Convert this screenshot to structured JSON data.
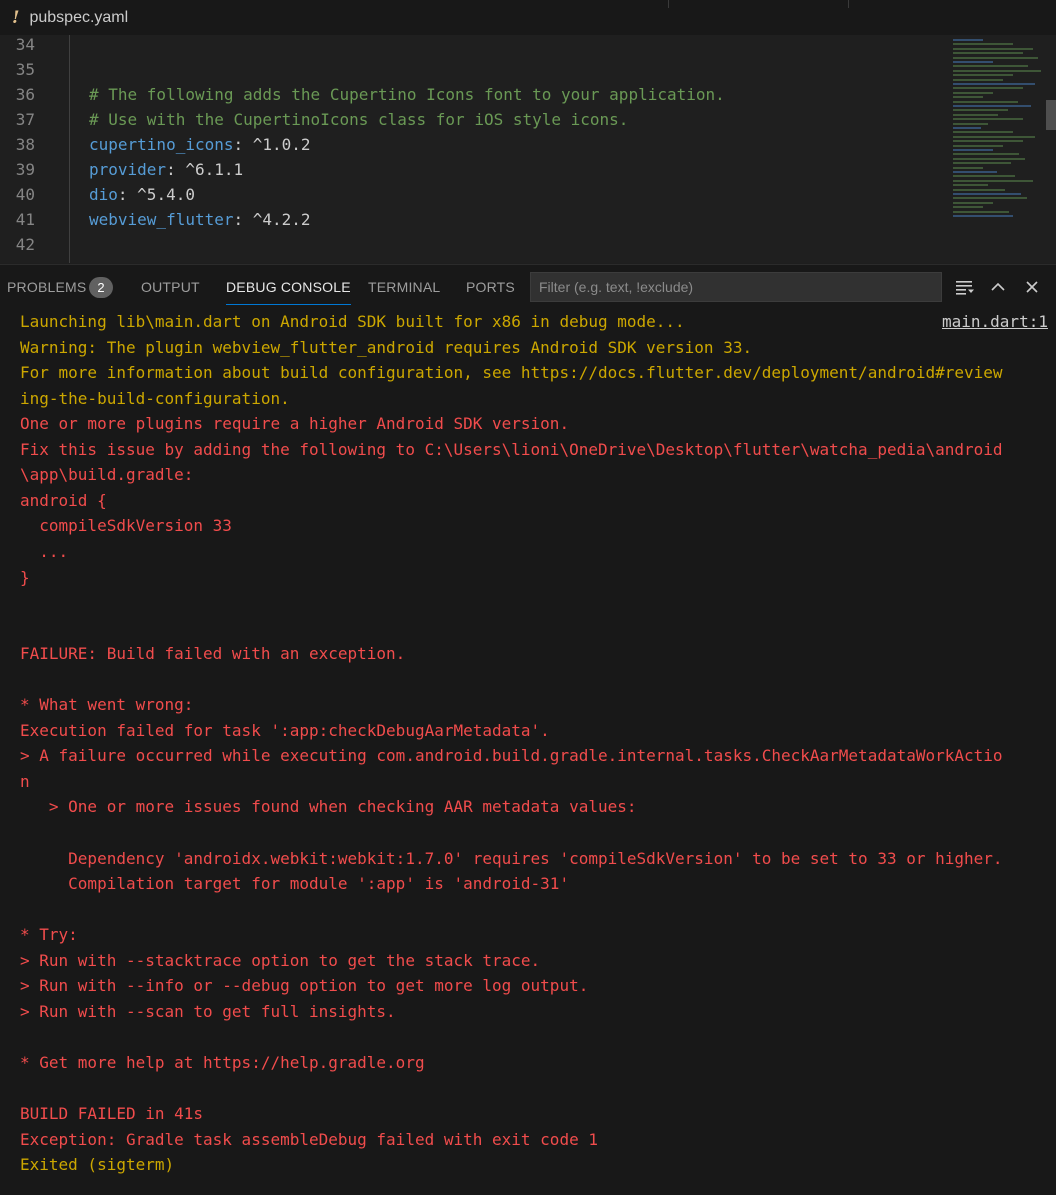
{
  "editor_tab": {
    "icon": "warning-icon",
    "label": "pubspec.yaml"
  },
  "editor": {
    "lines": [
      {
        "num": "34",
        "comment": "",
        "key": "",
        "sep": "",
        "value": ""
      },
      {
        "num": "35",
        "comment": "",
        "key": "",
        "sep": "",
        "value": ""
      },
      {
        "num": "36",
        "comment": "# The following adds the Cupertino Icons font to your application.",
        "key": "",
        "sep": "",
        "value": ""
      },
      {
        "num": "37",
        "comment": "# Use with the CupertinoIcons class for iOS style icons.",
        "key": "",
        "sep": "",
        "value": ""
      },
      {
        "num": "38",
        "comment": "",
        "key": "cupertino_icons",
        "sep": ": ",
        "value": "^1.0.2"
      },
      {
        "num": "39",
        "comment": "",
        "key": "provider",
        "sep": ": ",
        "value": "^6.1.1"
      },
      {
        "num": "40",
        "comment": "",
        "key": "dio",
        "sep": ": ",
        "value": "^5.4.0"
      },
      {
        "num": "41",
        "comment": "",
        "key": "webview_flutter",
        "sep": ": ",
        "value": "^4.2.2"
      },
      {
        "num": "42",
        "comment": "",
        "key": "",
        "sep": "",
        "value": ""
      }
    ]
  },
  "panel": {
    "tabs": [
      {
        "label": "PROBLEMS",
        "badge": "2"
      },
      {
        "label": "OUTPUT"
      },
      {
        "label": "DEBUG CONSOLE"
      },
      {
        "label": "TERMINAL"
      },
      {
        "label": "PORTS"
      }
    ],
    "active_tab": "DEBUG CONSOLE",
    "filter_placeholder": "Filter (e.g. text, !exclude)"
  },
  "console": {
    "source_link": "main.dart:1",
    "lines": [
      {
        "text": "Launching lib\\main.dart on Android SDK built for x86 in debug mode...",
        "color": "#cca700"
      },
      {
        "text": "Warning: The plugin webview_flutter_android requires Android SDK version 33.",
        "color": "#cca700"
      },
      {
        "text": "For more information about build configuration, see https://docs.flutter.dev/deployment/android#review",
        "color": "#cca700"
      },
      {
        "text": "ing-the-build-configuration.",
        "color": "#cca700"
      },
      {
        "text": "One or more plugins require a higher Android SDK version.",
        "color": "#f14c4c"
      },
      {
        "text": "Fix this issue by adding the following to C:\\Users\\lioni\\OneDrive\\Desktop\\flutter\\watcha_pedia\\android",
        "color": "#f14c4c"
      },
      {
        "text": "\\app\\build.gradle:",
        "color": "#f14c4c"
      },
      {
        "text": "android {",
        "color": "#f14c4c"
      },
      {
        "text": "  compileSdkVersion 33",
        "color": "#f14c4c"
      },
      {
        "text": "  ...",
        "color": "#f14c4c"
      },
      {
        "text": "}",
        "color": "#f14c4c"
      },
      {
        "text": "",
        "color": "#f14c4c"
      },
      {
        "text": "",
        "color": "#f14c4c"
      },
      {
        "text": "FAILURE: Build failed with an exception.",
        "color": "#f14c4c"
      },
      {
        "text": "",
        "color": "#f14c4c"
      },
      {
        "text": "* What went wrong:",
        "color": "#f14c4c"
      },
      {
        "text": "Execution failed for task ':app:checkDebugAarMetadata'.",
        "color": "#f14c4c"
      },
      {
        "text": "> A failure occurred while executing com.android.build.gradle.internal.tasks.CheckAarMetadataWorkActio",
        "color": "#f14c4c"
      },
      {
        "text": "n",
        "color": "#f14c4c"
      },
      {
        "text": "   > One or more issues found when checking AAR metadata values:",
        "color": "#f14c4c"
      },
      {
        "text": "",
        "color": "#f14c4c"
      },
      {
        "text": "     Dependency 'androidx.webkit:webkit:1.7.0' requires 'compileSdkVersion' to be set to 33 or higher.",
        "color": "#f14c4c"
      },
      {
        "text": "     Compilation target for module ':app' is 'android-31'",
        "color": "#f14c4c"
      },
      {
        "text": "",
        "color": "#f14c4c"
      },
      {
        "text": "* Try:",
        "color": "#f14c4c"
      },
      {
        "text": "> Run with --stacktrace option to get the stack trace.",
        "color": "#f14c4c"
      },
      {
        "text": "> Run with --info or --debug option to get more log output.",
        "color": "#f14c4c"
      },
      {
        "text": "> Run with --scan to get full insights.",
        "color": "#f14c4c"
      },
      {
        "text": "",
        "color": "#f14c4c"
      },
      {
        "text": "* Get more help at https://help.gradle.org",
        "color": "#f14c4c"
      },
      {
        "text": "",
        "color": "#f14c4c"
      },
      {
        "text": "BUILD FAILED in 41s",
        "color": "#f14c4c"
      },
      {
        "text": "Exception: Gradle task assembleDebug failed with exit code 1",
        "color": "#f14c4c"
      },
      {
        "text": "Exited (sigterm)",
        "color": "#cca700"
      }
    ]
  },
  "icons": {
    "panel_actions": [
      "list-filter-icon",
      "chevron-up-icon",
      "close-icon"
    ]
  },
  "colors": {
    "warning": "#cca700",
    "error": "#f14c4c",
    "accent": "#0078d4"
  }
}
